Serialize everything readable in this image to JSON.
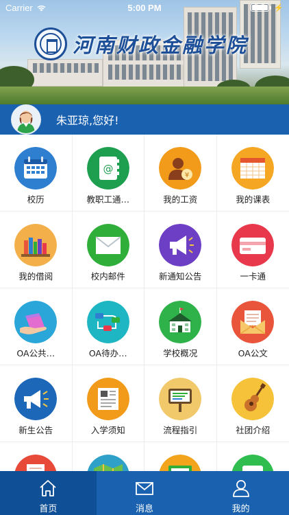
{
  "status_bar": {
    "carrier": "Carrier",
    "time": "5:00 PM"
  },
  "header": {
    "school_name": "河南财政金融学院"
  },
  "user": {
    "greeting": "朱亚琼,您好!"
  },
  "grid": {
    "items": [
      {
        "label": "校历",
        "icon": "calendar-icon",
        "color": "#2f7fd0"
      },
      {
        "label": "教职工通…",
        "icon": "address-book-icon",
        "color": "#1e9f4f"
      },
      {
        "label": "我的工资",
        "icon": "salary-icon",
        "color": "#f29b1a"
      },
      {
        "label": "我的课表",
        "icon": "timetable-icon",
        "color": "#f5a623"
      },
      {
        "label": "我的借阅",
        "icon": "books-icon",
        "color": "#f3b04a"
      },
      {
        "label": "校内邮件",
        "icon": "mail-icon",
        "color": "#2fae3a"
      },
      {
        "label": "新通知公告",
        "icon": "megaphone-icon",
        "color": "#6c3fc4"
      },
      {
        "label": "一卡通",
        "icon": "card-icon",
        "color": "#e8394c"
      },
      {
        "label": "OA公共…",
        "icon": "oa-folder-icon",
        "color": "#2aa6d8"
      },
      {
        "label": "OA待办…",
        "icon": "workflow-icon",
        "color": "#1fb6c4"
      },
      {
        "label": "学校概况",
        "icon": "school-icon",
        "color": "#2fb24a"
      },
      {
        "label": "OA公文",
        "icon": "document-envelope-icon",
        "color": "#e8553a"
      },
      {
        "label": "新生公告",
        "icon": "freshman-megaphone-icon",
        "color": "#1c67b7"
      },
      {
        "label": "入学须知",
        "icon": "newspaper-icon",
        "color": "#f29b1a"
      },
      {
        "label": "流程指引",
        "icon": "signboard-icon",
        "color": "#f1c86a"
      },
      {
        "label": "社团介绍",
        "icon": "guitar-icon",
        "color": "#f6c23a"
      },
      {
        "label": "",
        "icon": "partial-icon-1",
        "color": "#e84a3a"
      },
      {
        "label": "",
        "icon": "partial-map-icon",
        "color": "#2fa0c8"
      },
      {
        "label": "",
        "icon": "partial-icon-3",
        "color": "#f2a41d"
      },
      {
        "label": "",
        "icon": "partial-icon-4",
        "color": "#2ebd4e"
      }
    ]
  },
  "tabbar": {
    "tabs": [
      {
        "label": "首页",
        "icon": "home-icon",
        "active": true
      },
      {
        "label": "消息",
        "icon": "envelope-icon",
        "active": false
      },
      {
        "label": "我的",
        "icon": "person-icon",
        "active": false
      }
    ]
  },
  "colors": {
    "primary": "#1a62b0",
    "tab_active": "#0f4f96",
    "divider": "#ececec"
  }
}
